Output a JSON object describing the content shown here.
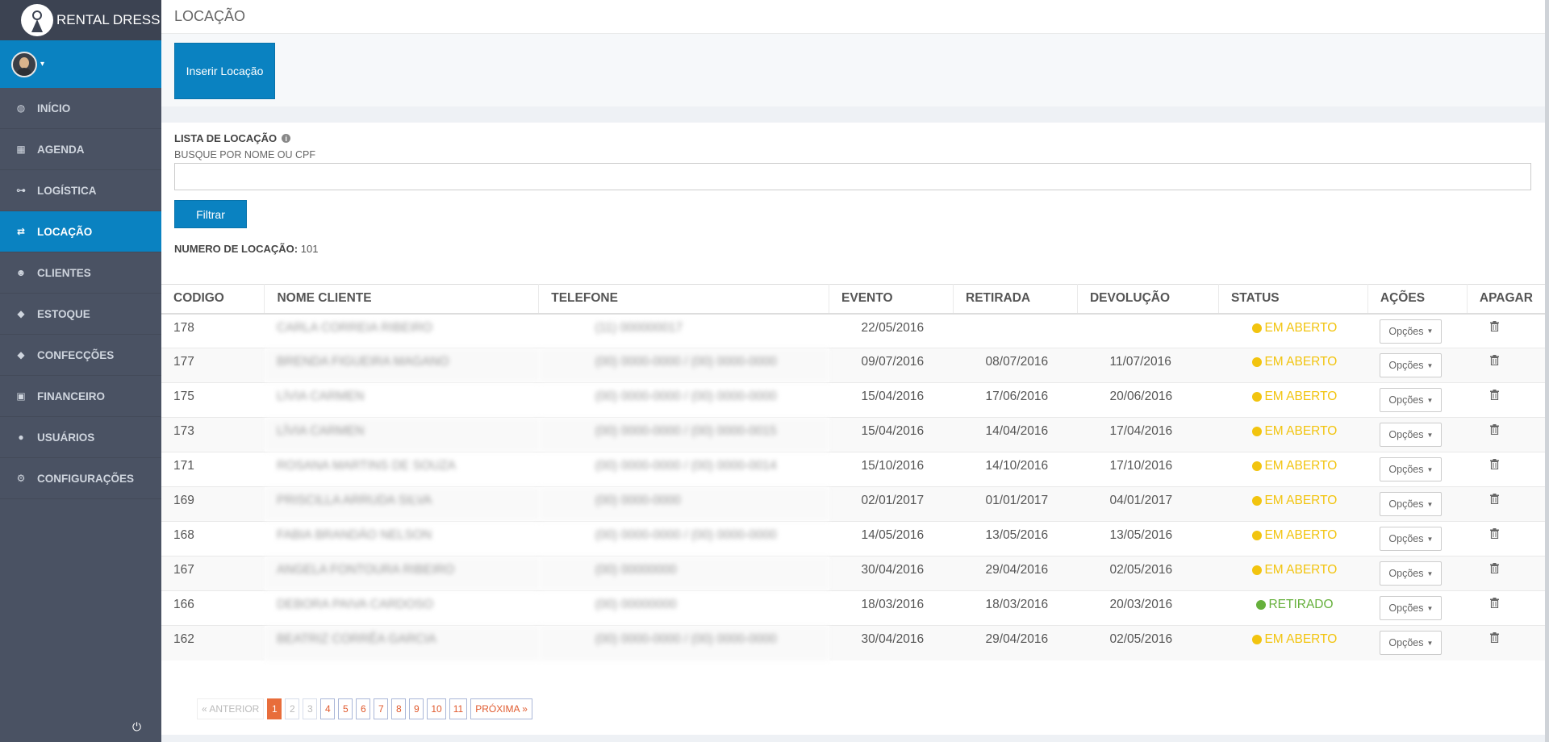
{
  "brand": {
    "name": "RENTAL DRESS"
  },
  "sidebar": {
    "items": [
      {
        "label": "INÍCIO",
        "icon": "dashboard-icon",
        "glyph": "◍",
        "active": false
      },
      {
        "label": "AGENDA",
        "icon": "calendar-icon",
        "glyph": "▦",
        "active": false
      },
      {
        "label": "LOGÍSTICA",
        "icon": "sitemap-icon",
        "glyph": "⊶",
        "active": false
      },
      {
        "label": "LOCAÇÃO",
        "icon": "exchange-icon",
        "glyph": "⇄",
        "active": true
      },
      {
        "label": "CLIENTES",
        "icon": "users-icon",
        "glyph": "☻",
        "active": false
      },
      {
        "label": "ESTOQUE",
        "icon": "tag-icon",
        "glyph": "◆",
        "active": false
      },
      {
        "label": "CONFECÇÕES",
        "icon": "tag-icon",
        "glyph": "◆",
        "active": false
      },
      {
        "label": "FINANCEIRO",
        "icon": "money-icon",
        "glyph": "▣",
        "active": false
      },
      {
        "label": "USUÁRIOS",
        "icon": "user-icon",
        "glyph": "●",
        "active": false
      },
      {
        "label": "CONFIGURAÇÕES",
        "icon": "cogs-icon",
        "glyph": "⚙",
        "active": false
      }
    ]
  },
  "header": {
    "title": "LOCAÇÃO"
  },
  "toolbar": {
    "insert_label": "Inserir Locação"
  },
  "panel": {
    "title": "LISTA DE LOCAÇÃO",
    "search_label": "BUSQUE POR NOME OU CPF",
    "search_value": "",
    "filter_label": "Filtrar",
    "count_label": "NUMERO DE LOCAÇÃO:",
    "count_value": "101"
  },
  "table": {
    "headers": [
      "CODIGO",
      "NOME CLIENTE",
      "TELEFONE",
      "EVENTO",
      "RETIRADA",
      "DEVOLUÇÃO",
      "STATUS",
      "AÇÕES",
      "APAGAR"
    ],
    "options_label": "Opções",
    "rows": [
      {
        "codigo": "178",
        "nome": "CARLA CORREIA RIBEIRO",
        "telefone": "(11) 000000017",
        "evento": "22/05/2016",
        "retirada": "",
        "devolucao": "",
        "status": "EM ABERTO",
        "status_type": "aberto"
      },
      {
        "codigo": "177",
        "nome": "BRENDA FIGUEIRA MAGANO",
        "telefone": "(00) 0000-0000 / (00) 0000-0000",
        "evento": "09/07/2016",
        "retirada": "08/07/2016",
        "devolucao": "11/07/2016",
        "status": "EM ABERTO",
        "status_type": "aberto"
      },
      {
        "codigo": "175",
        "nome": "LÍVIA CARMEN",
        "telefone": "(00) 0000-0000 / (00) 0000-0000",
        "evento": "15/04/2016",
        "retirada": "17/06/2016",
        "devolucao": "20/06/2016",
        "status": "EM ABERTO",
        "status_type": "aberto"
      },
      {
        "codigo": "173",
        "nome": "LÍVIA CARMEN",
        "telefone": "(00) 0000-0000 / (00) 0000-0015",
        "evento": "15/04/2016",
        "retirada": "14/04/2016",
        "devolucao": "17/04/2016",
        "status": "EM ABERTO",
        "status_type": "aberto"
      },
      {
        "codigo": "171",
        "nome": "ROSANA MARTINS DE SOUZA",
        "telefone": "(00) 0000-0000 / (00) 0000-0014",
        "evento": "15/10/2016",
        "retirada": "14/10/2016",
        "devolucao": "17/10/2016",
        "status": "EM ABERTO",
        "status_type": "aberto"
      },
      {
        "codigo": "169",
        "nome": "PRISCILLA ARRUDA SILVA",
        "telefone": "(00) 0000-0000",
        "evento": "02/01/2017",
        "retirada": "01/01/2017",
        "devolucao": "04/01/2017",
        "status": "EM ABERTO",
        "status_type": "aberto"
      },
      {
        "codigo": "168",
        "nome": "FABIA BRANDÃO NELSON",
        "telefone": "(00) 0000-0000 / (00) 0000-0000",
        "evento": "14/05/2016",
        "retirada": "13/05/2016",
        "devolucao": "13/05/2016",
        "status": "EM ABERTO",
        "status_type": "aberto"
      },
      {
        "codigo": "167",
        "nome": "ANGELA FONTOURA RIBEIRO",
        "telefone": "(00) 00000000",
        "evento": "30/04/2016",
        "retirada": "29/04/2016",
        "devolucao": "02/05/2016",
        "status": "EM ABERTO",
        "status_type": "aberto"
      },
      {
        "codigo": "166",
        "nome": "DEBORA PAIVA CARDOSO",
        "telefone": "(00) 00000000",
        "evento": "18/03/2016",
        "retirada": "18/03/2016",
        "devolucao": "20/03/2016",
        "status": "RETIRADO",
        "status_type": "retirado"
      },
      {
        "codigo": "162",
        "nome": "BEATRIZ CORRÊA GARCIA",
        "telefone": "(00) 0000-0000 / (00) 0000-0000",
        "evento": "30/04/2016",
        "retirada": "29/04/2016",
        "devolucao": "02/05/2016",
        "status": "EM ABERTO",
        "status_type": "aberto"
      }
    ]
  },
  "pagination": {
    "prev_label": "« ANTERIOR",
    "next_label": "PRÓXIMA »",
    "pages": [
      "1",
      "2",
      "3",
      "4",
      "5",
      "6",
      "7",
      "8",
      "9",
      "10",
      "11"
    ],
    "current": "1"
  },
  "colors": {
    "primary": "#0a82c1",
    "sidebar": "#4a5263",
    "status_aberto": "#f2c40f",
    "status_retirado": "#66b03c",
    "pager_current": "#e86d3b"
  }
}
